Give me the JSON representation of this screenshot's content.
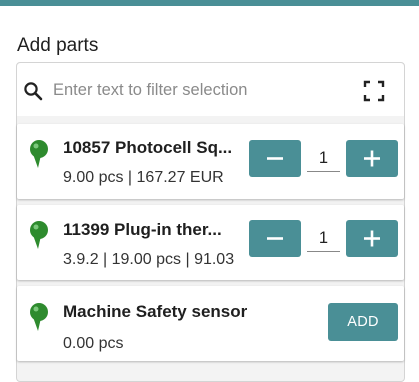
{
  "header": {
    "title": "Add parts"
  },
  "search": {
    "placeholder": "Enter text to filter selection",
    "value": ""
  },
  "parts": [
    {
      "name": "10857 Photocell Sq...",
      "info": "9.00 pcs | 167.27 EUR",
      "quantity": "1"
    },
    {
      "name": "11399 Plug-in ther...",
      "info": "3.9.2 | 19.00 pcs | 91.03",
      "quantity": "1"
    },
    {
      "name": "Machine Safety sensor",
      "info": "0.00 pcs",
      "add_label": "ADD"
    }
  ],
  "colors": {
    "accent": "#4a8f96",
    "pin_green": "#2e8b2e"
  },
  "icons": {
    "search": "search-icon",
    "expand": "expand-icon",
    "pin": "location-pin-icon",
    "minus": "minus-icon",
    "plus": "plus-icon"
  }
}
